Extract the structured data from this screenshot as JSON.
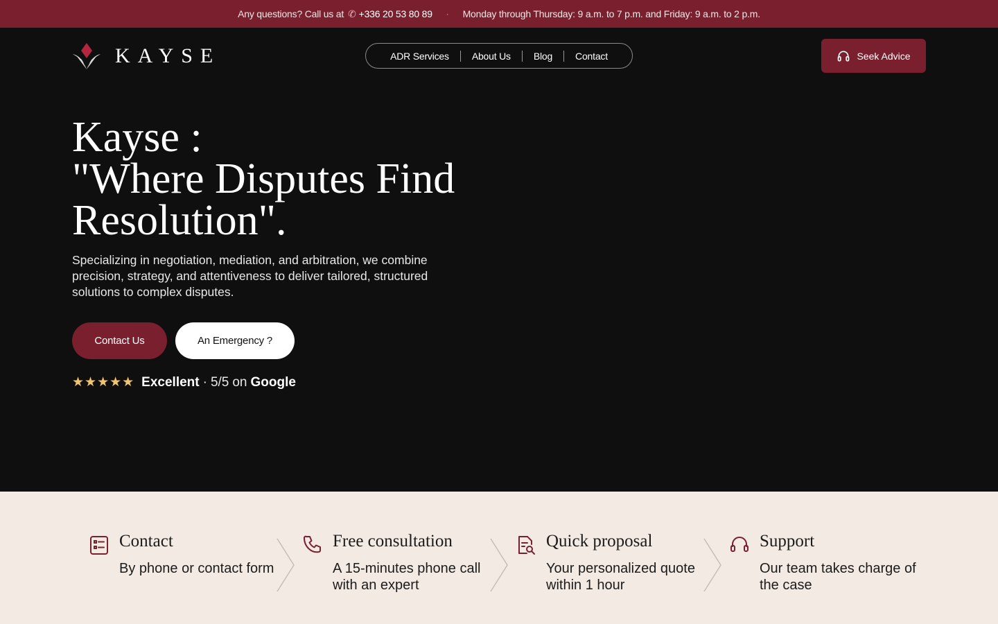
{
  "topbar": {
    "question": "Any questions? Call us at",
    "phone_icon": "phone-icon",
    "phone": "+336 20 53 80 89",
    "separator": "·",
    "hours": "Monday through Thursday: 9 a.m. to 7 p.m. and Friday: 9 a.m. to 2 p.m."
  },
  "brand": {
    "logo_icon": "diamond-logo-icon",
    "name": "KAYSE"
  },
  "nav": {
    "items": [
      "ADR Services",
      "About Us",
      "Blog",
      "Contact"
    ]
  },
  "header_cta": {
    "icon": "headset-icon",
    "label": "Seek Advice"
  },
  "hero": {
    "title_line1": "Kayse :",
    "title_line2": "\"Where Disputes Find",
    "title_line3": "Resolution\".",
    "subtitle": "Specializing in negotiation, mediation, and arbitration, we combine precision, strategy, and attentiveness to deliver tailored, structured solutions to complex disputes.",
    "primary_button": "Contact Us",
    "secondary_button": "An Emergency ?",
    "rating": {
      "stars": "★★★★★",
      "stars_value": 5,
      "label": "Excellent",
      "dot": "·",
      "score": "5/5",
      "on": "on",
      "source": "Google"
    }
  },
  "steps": [
    {
      "icon": "form-list-icon",
      "title": "Contact",
      "desc": "By phone or contact form"
    },
    {
      "icon": "phone-icon",
      "title": "Free consultation",
      "desc": "A 15-minutes phone call with an expert"
    },
    {
      "icon": "document-search-icon",
      "title": "Quick proposal",
      "desc": "Your personalized quote within 1 hour"
    },
    {
      "icon": "headset-icon",
      "title": "Support",
      "desc": "Our team takes charge of the case"
    }
  ],
  "colors": {
    "brand": "#7a1f2e",
    "background": "#0f0f10",
    "steps_background": "#f3ebe3",
    "star": "#f2c46d"
  }
}
